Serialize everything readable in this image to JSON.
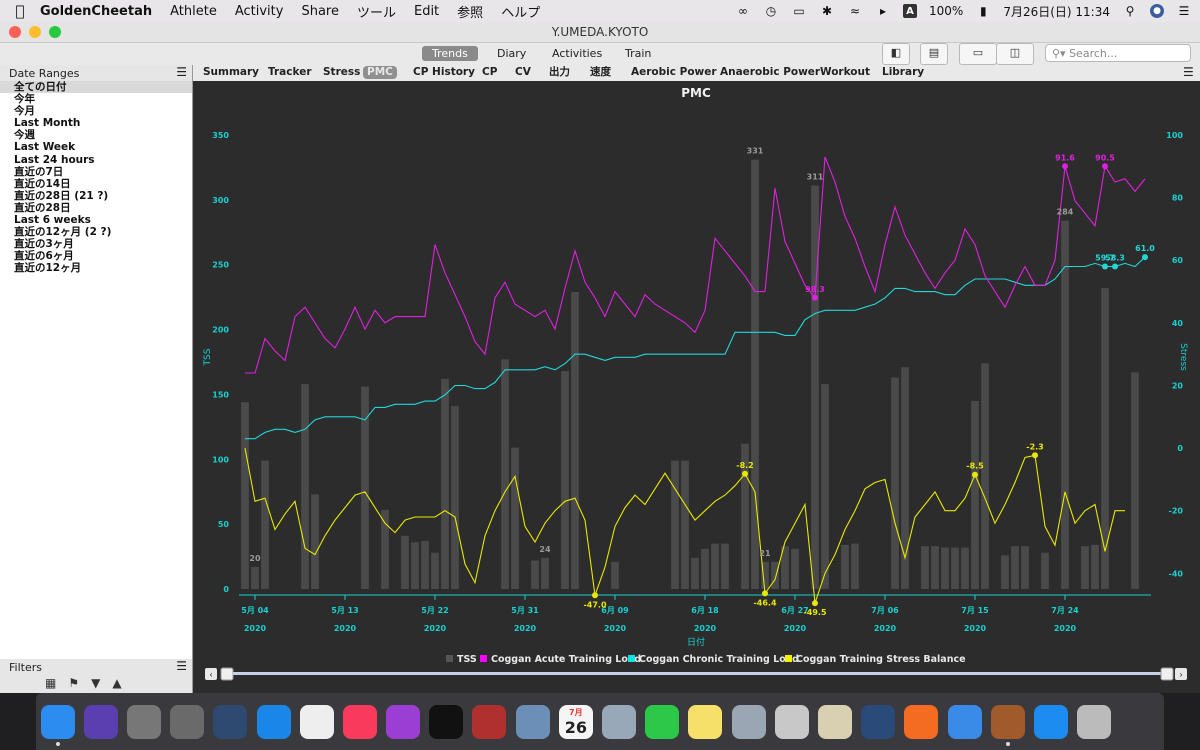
{
  "menubar": {
    "app": "GoldenCheetah",
    "items": [
      "Athlete",
      "Activity",
      "Share",
      "ツール",
      "Edit",
      "参照",
      "ヘルプ"
    ],
    "battery": "100%",
    "clock": "7月26日(日)  11:34",
    "input_source": "A"
  },
  "window": {
    "title": "Y.UMEDA.KYOTO"
  },
  "toolbar": {
    "modes": [
      "Trends",
      "Diary",
      "Activities",
      "Train"
    ],
    "active_mode": "Trends",
    "search_placeholder": "Search..."
  },
  "sidebar": {
    "date_ranges_label": "Date Ranges",
    "date_ranges": [
      "全ての日付",
      "今年",
      "今月",
      "Last Month",
      "今週",
      "Last Week",
      "Last 24 hours",
      "直近の7日",
      "直近の14日",
      "直近の28日 (21 ?)",
      "直近の28日",
      "Last 6 weeks",
      "直近の12ヶ月 (2 ?)",
      "直近の3ヶ月",
      "直近の6ヶ月",
      "直近の12ヶ月"
    ],
    "selected_index": 0,
    "filters_label": "Filters"
  },
  "chart_tabs": [
    "Summary",
    "Tracker",
    "Stress",
    "PMC",
    "CP History",
    "CP",
    "CV",
    "出力",
    "速度",
    "Aerobic Power",
    "Anaerobic Power",
    "Workout",
    "Library"
  ],
  "active_chart_tab": "PMC",
  "chart_data": {
    "type": "bar+line",
    "title": "PMC",
    "xlabel": "日付",
    "ylabel_left": "TSS",
    "ylabel_right": "Stress",
    "ylim_left": [
      0,
      350
    ],
    "ylim_right": [
      -45,
      100
    ],
    "left_ticks": [
      0,
      50,
      100,
      150,
      200,
      250,
      300,
      350
    ],
    "right_ticks": [
      -40,
      -20,
      0,
      20,
      40,
      60,
      80,
      100
    ],
    "x_ticks": [
      "5月 04",
      "5月 13",
      "5月 22",
      "5月 31",
      "6月 09",
      "6月 18",
      "6月 27",
      "7月 06",
      "7月 15",
      "7月 24"
    ],
    "x_tick_year": "2020",
    "start_date": "2020-05-03",
    "tss": [
      144,
      17,
      99,
      0,
      0,
      0,
      158,
      73,
      0,
      0,
      0,
      0,
      156,
      0,
      61,
      0,
      41,
      36,
      37,
      28,
      162,
      141,
      0,
      0,
      0,
      0,
      177,
      109,
      0,
      22,
      24,
      0,
      168,
      229,
      0,
      0,
      0,
      21,
      0,
      0,
      0,
      0,
      0,
      99,
      99,
      24,
      31,
      35,
      35,
      0,
      112,
      331,
      21,
      21,
      33,
      31,
      0,
      311,
      158,
      0,
      34,
      35,
      0,
      0,
      0,
      163,
      171,
      0,
      33,
      33,
      32,
      32,
      32,
      145,
      174,
      0,
      26,
      33,
      33,
      0,
      28,
      0,
      284,
      0,
      33,
      34,
      232,
      0,
      0,
      167
    ],
    "atl": [
      24,
      24,
      35,
      31,
      28,
      42,
      45,
      40,
      35,
      32,
      38,
      45,
      38,
      44,
      40,
      42,
      42,
      42,
      42,
      65,
      56,
      49,
      42,
      34,
      30,
      48,
      53,
      46,
      44,
      42,
      44,
      38,
      51,
      63,
      53,
      48,
      42,
      50,
      46,
      42,
      49,
      46,
      44,
      42,
      40,
      37,
      44,
      67,
      63,
      59,
      55,
      50,
      50,
      83,
      66,
      59,
      52,
      48,
      93,
      85,
      74,
      67,
      58,
      50,
      65,
      77,
      68,
      62,
      56,
      51,
      56,
      60,
      70,
      65,
      55,
      50,
      45,
      52,
      58,
      52,
      52,
      60,
      90,
      79,
      75,
      71,
      90,
      85,
      86,
      82,
      86
    ],
    "ctl": [
      3,
      3,
      5,
      6,
      6,
      5,
      6,
      9,
      10,
      10,
      10,
      10,
      9,
      13,
      13,
      14,
      14,
      14,
      15,
      15,
      17,
      20,
      20,
      19,
      19,
      21,
      25,
      25,
      25,
      25,
      26,
      25,
      27,
      30,
      30,
      29,
      28,
      29,
      29,
      29,
      30,
      30,
      30,
      30,
      30,
      30,
      30,
      30,
      30,
      37,
      37,
      37,
      37,
      37,
      36,
      36,
      41,
      43,
      44,
      44,
      44,
      44,
      45,
      46,
      48,
      51,
      51,
      50,
      50,
      50,
      49,
      49,
      52,
      54,
      54,
      54,
      54,
      53,
      52,
      52,
      52,
      54,
      58,
      58,
      58,
      59,
      58,
      58,
      59,
      58,
      61
    ],
    "tsb": [
      0,
      -17,
      -16,
      -26,
      -21,
      -17,
      -32,
      -34,
      -28,
      -23,
      -19,
      -15,
      -14,
      -19,
      -24,
      -27,
      -23,
      -22,
      -22,
      -22,
      -20,
      -22,
      -37,
      -43,
      -28,
      -20,
      -14,
      -9,
      -25,
      -30,
      -24,
      -20,
      -17,
      -16,
      -23,
      -47,
      -38,
      -25,
      -19,
      -15,
      -18,
      -13,
      -8,
      -13,
      -18,
      -23,
      -20,
      -17,
      -15,
      -12,
      -8.2,
      -14,
      -46.4,
      -42,
      -30,
      -24,
      -18,
      -49.5,
      -40,
      -34,
      -26,
      -20,
      -13,
      -11,
      -10,
      -24,
      -35,
      -22,
      -18,
      -14,
      -20,
      -20,
      -16,
      -8.5,
      -16,
      -24,
      -18,
      -11,
      -3,
      -2.3,
      -25,
      -31,
      -14,
      -24,
      -20,
      -18,
      -33,
      -20,
      -20
    ],
    "point_labels": [
      {
        "series": "Coggan Acute Training Load",
        "index": 57,
        "label": "98.3"
      },
      {
        "series": "Coggan Acute Training Load",
        "index": 82,
        "label": "91.6"
      },
      {
        "series": "Coggan Acute Training Load",
        "index": 86,
        "label": "90.5"
      },
      {
        "series": "Coggan Chronic Training Load",
        "index": 86,
        "label": "59.7"
      },
      {
        "series": "Coggan Chronic Training Load",
        "index": 87,
        "label": "58.3"
      },
      {
        "series": "Coggan Chronic Training Load",
        "index": 90,
        "label": "61.0"
      },
      {
        "series": "Coggan Training Stress Balance",
        "index": 35,
        "label": "-47.0"
      },
      {
        "series": "Coggan Training Stress Balance",
        "index": 50,
        "label": "-8.2"
      },
      {
        "series": "Coggan Training Stress Balance",
        "index": 52,
        "label": "-46.4"
      },
      {
        "series": "Coggan Training Stress Balance",
        "index": 57,
        "label": "-49.5"
      },
      {
        "series": "Coggan Training Stress Balance",
        "index": 73,
        "label": "-8.5"
      },
      {
        "series": "Coggan Training Stress Balance",
        "index": 79,
        "label": "-2.3"
      },
      {
        "series": "TSS",
        "index": 1,
        "label": "20"
      },
      {
        "series": "TSS",
        "index": 30,
        "label": "24"
      },
      {
        "series": "TSS",
        "index": 51,
        "label": "331"
      },
      {
        "series": "TSS",
        "index": 52,
        "label": "21"
      },
      {
        "series": "TSS",
        "index": 57,
        "label": "311"
      },
      {
        "series": "TSS",
        "index": 82,
        "label": "284"
      }
    ],
    "legend": [
      {
        "name": "TSS",
        "color": "#555555"
      },
      {
        "name": "Coggan Acute Training Load",
        "color": "#ff00ff"
      },
      {
        "name": "Coggan Chronic Training Load",
        "color": "#00e5e5"
      },
      {
        "name": "Coggan Training Stress Balance",
        "color": "#f0f000"
      }
    ],
    "legend_placement": "bottom-center",
    "grid": false
  },
  "colors": {
    "atl": "#e020e0",
    "ctl": "#20d8d8",
    "tsb": "#e8e800",
    "bar": "#4a4a4a",
    "axis": "#18d0d0"
  },
  "dock": {
    "apps": [
      {
        "name": "finder-icon",
        "color": "#2c8cf0"
      },
      {
        "name": "siri-icon",
        "color": "#5a3fb0"
      },
      {
        "name": "launchpad-icon",
        "color": "#777777"
      },
      {
        "name": "system-preferences-icon",
        "color": "#6a6a6a"
      },
      {
        "name": "mission-control-icon",
        "color": "#2f4a70"
      },
      {
        "name": "safari-icon",
        "color": "#1a86e8"
      },
      {
        "name": "photos-icon",
        "color": "#eeeeee"
      },
      {
        "name": "music-icon",
        "color": "#fa3a5c"
      },
      {
        "name": "podcasts-icon",
        "color": "#9b3fd4"
      },
      {
        "name": "tv-icon",
        "color": "#111111"
      },
      {
        "name": "photo-booth-icon",
        "color": "#b03030"
      },
      {
        "name": "preview-icon",
        "color": "#6c8fb8"
      },
      {
        "name": "calendar-icon",
        "color": "#f5f5f5"
      },
      {
        "name": "migration-icon",
        "color": "#98a8b8"
      },
      {
        "name": "facetime-icon",
        "color": "#2cc84a"
      },
      {
        "name": "notes-icon",
        "color": "#f7e06a"
      },
      {
        "name": "blocked-app-1-icon",
        "color": "#9aa6b3"
      },
      {
        "name": "blocked-app-2-icon",
        "color": "#c8c8c8"
      },
      {
        "name": "blocked-app-3-icon",
        "color": "#d8d0b0"
      },
      {
        "name": "network-icon",
        "color": "#2a4a7a"
      },
      {
        "name": "zwift-icon",
        "color": "#f36c21"
      },
      {
        "name": "maps-icon",
        "color": "#3a8ae8"
      },
      {
        "name": "goldencheetah-icon",
        "color": "#a05a2c"
      },
      {
        "name": "app-store-icon",
        "color": "#1c8cf0"
      },
      {
        "name": "trash-icon",
        "color": "#bbbbbb"
      }
    ],
    "calendar_day": "26",
    "calendar_month": "7月"
  }
}
